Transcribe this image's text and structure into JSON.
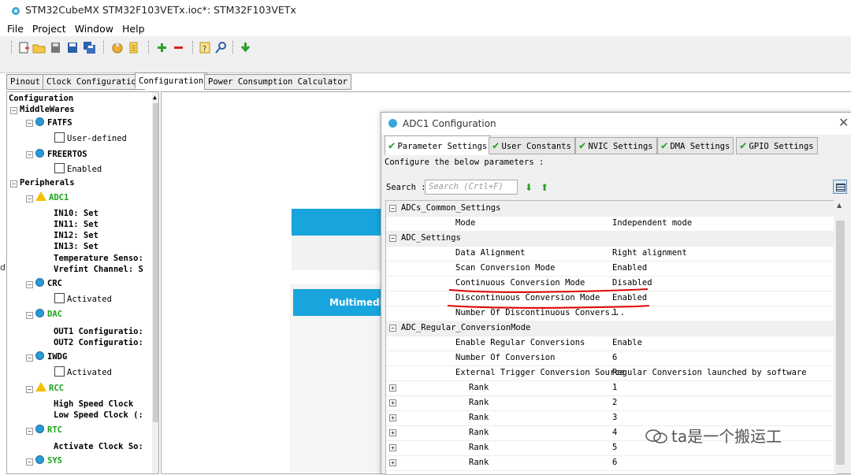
{
  "window": {
    "title": "STM32CubeMX STM32F103VETx.ioc*: STM32F103VETx"
  },
  "menu": [
    "File",
    "Project",
    "Window",
    "Help"
  ],
  "toolbar": {
    "icons": [
      "new-project-icon",
      "open-folder-icon",
      "save-icon",
      "save-as-icon",
      "save-all-icon",
      "generate-report-icon",
      "generate-code-icon",
      "add-icon",
      "remove-icon",
      "help-icon",
      "search-icon",
      "download-icon"
    ]
  },
  "main_tabs": [
    "Pinout",
    "Clock Configuration",
    "Configuration",
    "Power Consumption Calculator"
  ],
  "main_tab_active": "Configuration",
  "tree": {
    "root": "Configuration",
    "middlewares": {
      "label": "MiddleWares",
      "items": [
        {
          "label": "FATFS",
          "child": "User-defined"
        },
        {
          "label": "FREERTOS",
          "child": "Enabled"
        }
      ]
    },
    "peripherals": {
      "label": "Peripherals",
      "adc1": {
        "label": "ADC1",
        "children": [
          "IN10: Set",
          "IN11: Set",
          "IN12: Set",
          "IN13: Set",
          "Temperature Senso:",
          "Vrefint Channel: S"
        ]
      },
      "crc": {
        "label": "CRC",
        "child": "Activated"
      },
      "dac": {
        "label": "DAC",
        "children": [
          "OUT1 Configuratio:",
          "OUT2 Configuratio:"
        ]
      },
      "iwdg": {
        "label": "IWDG",
        "child": "Activated"
      },
      "rcc": {
        "label": "RCC",
        "children": [
          "High Speed Clock",
          "Low Speed Clock (:"
        ]
      },
      "rtc": {
        "label": "RTC",
        "children": [
          "Activate Clock So:"
        ]
      },
      "sys": {
        "label": "SYS"
      }
    }
  },
  "background": {
    "multimedia_label": "Multimedi",
    "edge_glyph": "d"
  },
  "dialog": {
    "title": "ADC1 Configuration",
    "tabs": [
      "Parameter Settings",
      "User Constants",
      "NVIC Settings",
      "DMA Settings",
      "GPIO Settings"
    ],
    "active_tab": "Parameter Settings",
    "instructions": "Configure the below parameters :",
    "search_label": "Search :",
    "search_placeholder": "Search (Crtl+F)",
    "groups": [
      {
        "name": "ADCs_Common_Settings",
        "params": [
          {
            "name": "Mode",
            "value": "Independent mode"
          }
        ]
      },
      {
        "name": "ADC_Settings",
        "params": [
          {
            "name": "Data Alignment",
            "value": "Right alignment"
          },
          {
            "name": "Scan Conversion Mode",
            "value": "Enabled"
          },
          {
            "name": "Continuous Conversion Mode",
            "value": "Disabled"
          },
          {
            "name": "Discontinuous Conversion Mode",
            "value": "Enabled"
          },
          {
            "name": "Number Of Discontinuous Convers...",
            "value": "1"
          }
        ]
      },
      {
        "name": "ADC_Regular_ConversionMode",
        "params": [
          {
            "name": "Enable Regular Conversions",
            "value": "Enable"
          },
          {
            "name": "Number Of Conversion",
            "value": "6"
          },
          {
            "name": "External Trigger Conversion Source",
            "value": "Regular Conversion launched by software"
          }
        ],
        "ranks": [
          {
            "name": "Rank",
            "value": "1"
          },
          {
            "name": "Rank",
            "value": "2"
          },
          {
            "name": "Rank",
            "value": "3"
          },
          {
            "name": "Rank",
            "value": "4"
          },
          {
            "name": "Rank",
            "value": "5"
          },
          {
            "name": "Rank",
            "value": "6"
          }
        ]
      }
    ]
  },
  "watermark": "ta是一个搬运工",
  "colors": {
    "accent_blue": "#18a4dc",
    "check_green": "#22a022",
    "annotation_red": "#e00000",
    "warning_yellow": "#f3c000"
  }
}
